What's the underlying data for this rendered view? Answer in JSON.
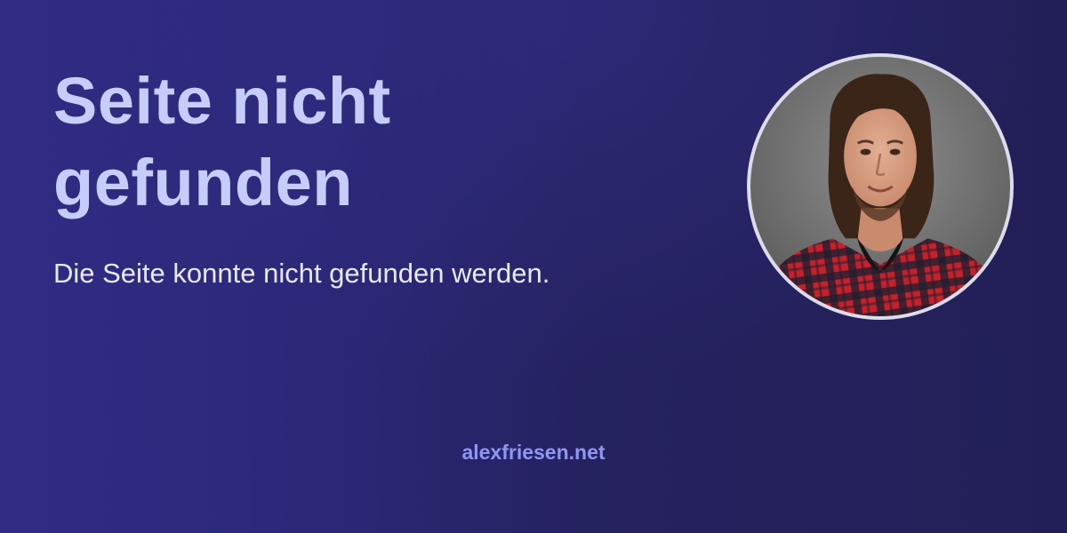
{
  "page": {
    "title": "Seite nicht gefunden",
    "subtitle": "Die Seite konnte nicht gefunden werden.",
    "domain": "alexfriesen.net"
  },
  "avatar": {
    "icon": "profile-photo",
    "background": "#6d6d6d",
    "shirt_colors": [
      "#c4212c",
      "#1c1f2e"
    ]
  },
  "colors": {
    "background_dark": "#221f58",
    "background_light": "#302c84",
    "title": "#c7cdfb",
    "subtitle": "#e6e8fb",
    "domain": "#8f96f3"
  }
}
